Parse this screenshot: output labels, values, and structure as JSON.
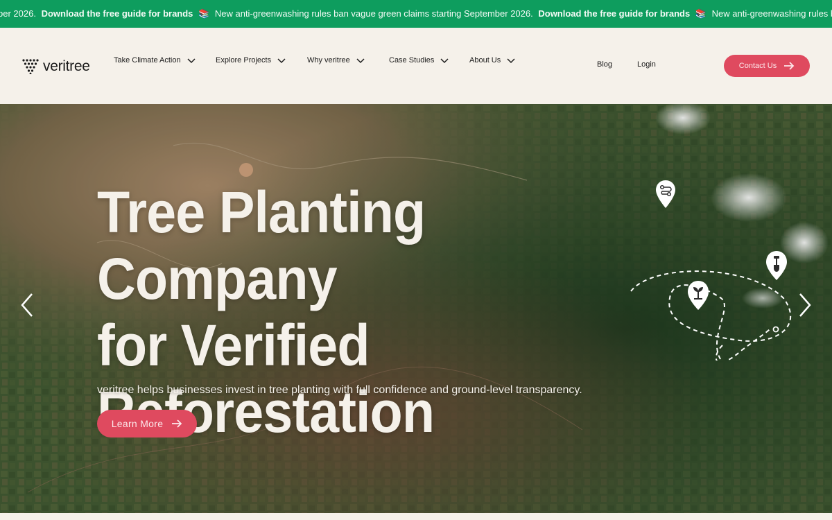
{
  "ticker": {
    "lead": "ber 2026.",
    "cta": "Download the free guide for brands",
    "emoji": "📚",
    "notice": "New anti-greenwashing rules ban vague green claims starting September 2026."
  },
  "brand": {
    "name": "veritree",
    "accent": "#df4a5f",
    "ticker_color": "#0e9d5e"
  },
  "nav": {
    "items": [
      {
        "label": "Take Climate Action"
      },
      {
        "label": "Explore Projects"
      },
      {
        "label": "Why veritree"
      },
      {
        "label": "Case Studies"
      },
      {
        "label": "About Us"
      }
    ],
    "blog": "Blog",
    "login": "Login",
    "contact": "Contact Us"
  },
  "hero": {
    "title_line1": "Tree Planting Company",
    "title_line2": "for Verified",
    "title_line3": "Reforestation",
    "subtitle": "veritree helps businesses invest in tree planting with full confidence and ground-level transparency.",
    "cta": "Learn More"
  },
  "icons": {
    "prev": "chevron-left-icon",
    "next": "chevron-right-icon",
    "markers": [
      "route-pin-icon",
      "sprout-pin-icon",
      "shovel-pin-icon"
    ]
  }
}
